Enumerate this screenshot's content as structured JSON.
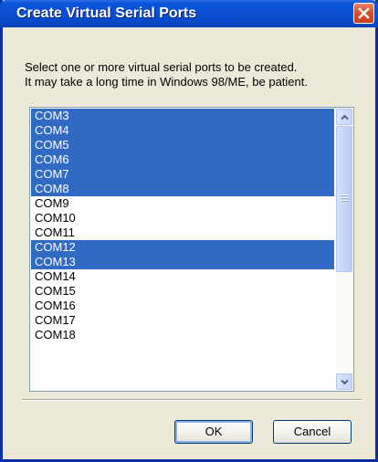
{
  "window": {
    "title": "Create Virtual Serial Ports"
  },
  "description": {
    "line1": "Select one or more virtual serial ports to be created.",
    "line2": "It may take a long time in Windows 98/ME, be patient."
  },
  "ports": [
    {
      "label": "COM3",
      "selected": true
    },
    {
      "label": "COM4",
      "selected": true
    },
    {
      "label": "COM5",
      "selected": true
    },
    {
      "label": "COM6",
      "selected": true
    },
    {
      "label": "COM7",
      "selected": true
    },
    {
      "label": "COM8",
      "selected": true
    },
    {
      "label": "COM9",
      "selected": false
    },
    {
      "label": "COM10",
      "selected": false
    },
    {
      "label": "COM11",
      "selected": false
    },
    {
      "label": "COM12",
      "selected": true
    },
    {
      "label": "COM13",
      "selected": true
    },
    {
      "label": "COM14",
      "selected": false
    },
    {
      "label": "COM15",
      "selected": false
    },
    {
      "label": "COM16",
      "selected": false
    },
    {
      "label": "COM17",
      "selected": false
    },
    {
      "label": "COM18",
      "selected": false
    }
  ],
  "buttons": {
    "ok": "OK",
    "cancel": "Cancel"
  },
  "colors": {
    "selection": "#316ac5",
    "titlebar": "#0a4fd0",
    "close": "#d8512e"
  },
  "icons": {
    "close": "close-icon",
    "scroll_up": "chevron-up-icon",
    "scroll_down": "chevron-down-icon"
  }
}
